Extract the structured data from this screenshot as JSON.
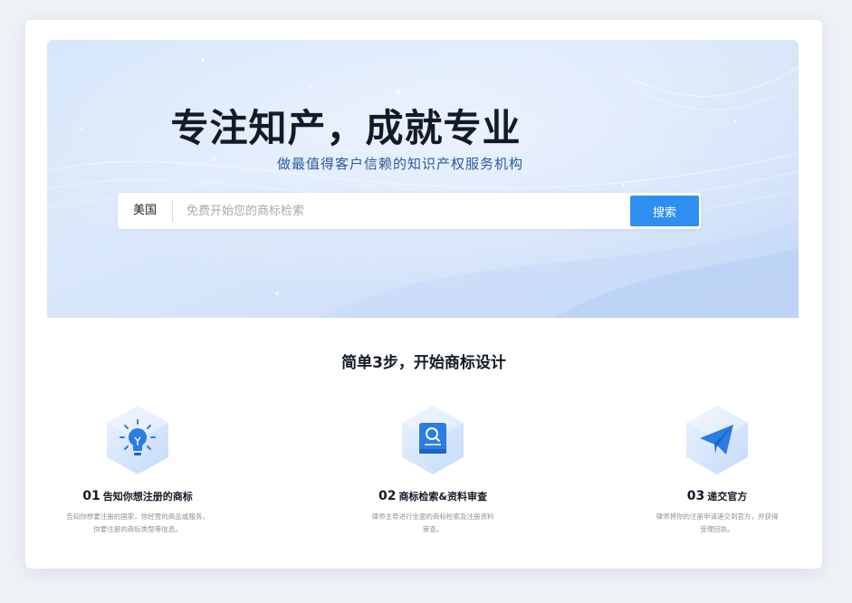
{
  "hero": {
    "title": "专注知产，成就专业",
    "subtitle": "做最值得客户信赖的知识产权服务机构"
  },
  "search": {
    "country": "美国",
    "placeholder": "免费开始您的商标检索",
    "button_label": "搜索"
  },
  "steps_section": {
    "title": "简单3步，开始商标设计",
    "steps": [
      {
        "number": "01",
        "title": "告知你想注册的商标",
        "description": "告知你想要注册的国家，你经营的商品或服务，你要注册的商标类型等信息。",
        "icon": "lightbulb-icon"
      },
      {
        "number": "02",
        "title": "商标检索&资料审查",
        "description": "律师主导进行全面的商标检索及注册资料审查。",
        "icon": "search-document-icon"
      },
      {
        "number": "03",
        "title": "递交官方",
        "description": "律师将你的注册申请递交到官方，并获得受理回执。",
        "icon": "paper-plane-icon"
      }
    ]
  },
  "colors": {
    "accent": "#2e8ff0",
    "subtitle": "#2b5aa0",
    "icon_blue": "#2a7de1"
  }
}
